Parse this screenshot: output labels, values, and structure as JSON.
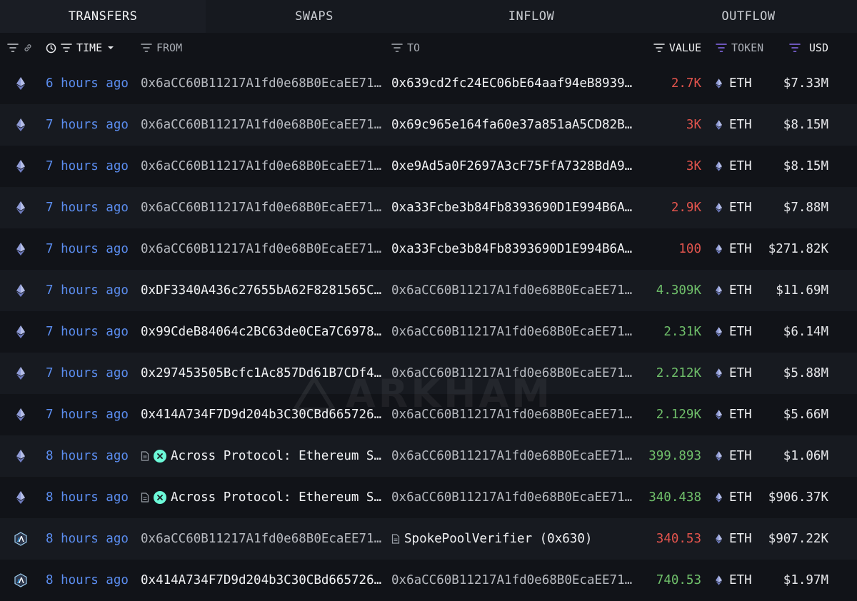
{
  "tabs": [
    {
      "label": "TRANSFERS",
      "active": true
    },
    {
      "label": "SWAPS",
      "active": false
    },
    {
      "label": "INFLOW",
      "active": false
    },
    {
      "label": "OUTFLOW",
      "active": false
    }
  ],
  "columns": {
    "time": "TIME",
    "from": "FROM",
    "to": "TO",
    "value": "VALUE",
    "token": "TOKEN",
    "usd": "USD"
  },
  "colors": {
    "negative": "#e2544d",
    "positive": "#6fbf6a",
    "time_link": "#5b8def",
    "filter_active": "#8b6cf0"
  },
  "watermark": "ARKHAM",
  "rows": [
    {
      "chain_icon": "ethereum-icon",
      "time": "6 hours ago",
      "from": "0x6aCC60B11217A1fd0e68B0EcaEE71…",
      "from_entity": false,
      "to": "0x639cd2fc24EC06bE64aaf94eB8939…",
      "to_entity": false,
      "value": "2.7K",
      "direction": "out",
      "token": "ETH",
      "usd": "$7.33M"
    },
    {
      "chain_icon": "ethereum-icon",
      "time": "7 hours ago",
      "from": "0x6aCC60B11217A1fd0e68B0EcaEE71…",
      "from_entity": false,
      "to": "0x69c965e164fa60e37a851aA5CD82B…",
      "to_entity": false,
      "value": "3K",
      "direction": "out",
      "token": "ETH",
      "usd": "$8.15M"
    },
    {
      "chain_icon": "ethereum-icon",
      "time": "7 hours ago",
      "from": "0x6aCC60B11217A1fd0e68B0EcaEE71…",
      "from_entity": false,
      "to": "0xe9Ad5a0F2697A3cF75FfA7328BdA9…",
      "to_entity": false,
      "value": "3K",
      "direction": "out",
      "token": "ETH",
      "usd": "$8.15M"
    },
    {
      "chain_icon": "ethereum-icon",
      "time": "7 hours ago",
      "from": "0x6aCC60B11217A1fd0e68B0EcaEE71…",
      "from_entity": false,
      "to": "0xa33Fcbe3b84Fb8393690D1E994B6A…",
      "to_entity": false,
      "value": "2.9K",
      "direction": "out",
      "token": "ETH",
      "usd": "$7.88M"
    },
    {
      "chain_icon": "ethereum-icon",
      "time": "7 hours ago",
      "from": "0x6aCC60B11217A1fd0e68B0EcaEE71…",
      "from_entity": false,
      "to": "0xa33Fcbe3b84Fb8393690D1E994B6A…",
      "to_entity": false,
      "value": "100",
      "direction": "out",
      "token": "ETH",
      "usd": "$271.82K"
    },
    {
      "chain_icon": "ethereum-icon",
      "time": "7 hours ago",
      "from": "0xDF3340A436c27655bA62F8281565C…",
      "from_entity": false,
      "to": "0x6aCC60B11217A1fd0e68B0EcaEE71…",
      "to_entity": false,
      "value": "4.309K",
      "direction": "in",
      "token": "ETH",
      "usd": "$11.69M"
    },
    {
      "chain_icon": "ethereum-icon",
      "time": "7 hours ago",
      "from": "0x99CdeB84064c2BC63de0CEa7C6978…",
      "from_entity": false,
      "to": "0x6aCC60B11217A1fd0e68B0EcaEE71…",
      "to_entity": false,
      "value": "2.31K",
      "direction": "in",
      "token": "ETH",
      "usd": "$6.14M"
    },
    {
      "chain_icon": "ethereum-icon",
      "time": "7 hours ago",
      "from": "0x297453505Bcfc1Ac857Dd61B7CDf4…",
      "from_entity": false,
      "to": "0x6aCC60B11217A1fd0e68B0EcaEE71…",
      "to_entity": false,
      "value": "2.212K",
      "direction": "in",
      "token": "ETH",
      "usd": "$5.88M"
    },
    {
      "chain_icon": "ethereum-icon",
      "time": "7 hours ago",
      "from": "0x414A734F7D9d204b3C30CBd665726…",
      "from_entity": false,
      "to": "0x6aCC60B11217A1fd0e68B0EcaEE71…",
      "to_entity": false,
      "value": "2.129K",
      "direction": "in",
      "token": "ETH",
      "usd": "$5.66M"
    },
    {
      "chain_icon": "ethereum-icon",
      "time": "8 hours ago",
      "from": "Across Protocol: Ethereum S…",
      "from_entity": true,
      "to": "0x6aCC60B11217A1fd0e68B0EcaEE71…",
      "to_entity": false,
      "value": "399.893",
      "direction": "in",
      "token": "ETH",
      "usd": "$1.06M"
    },
    {
      "chain_icon": "ethereum-icon",
      "time": "8 hours ago",
      "from": "Across Protocol: Ethereum S…",
      "from_entity": true,
      "to": "0x6aCC60B11217A1fd0e68B0EcaEE71…",
      "to_entity": false,
      "value": "340.438",
      "direction": "in",
      "token": "ETH",
      "usd": "$906.37K"
    },
    {
      "chain_icon": "arbitrum-icon",
      "time": "8 hours ago",
      "from": "0x6aCC60B11217A1fd0e68B0EcaEE71…",
      "from_entity": false,
      "to": "SpokePoolVerifier (0x630)",
      "to_entity": true,
      "value": "340.53",
      "direction": "out",
      "token": "ETH",
      "usd": "$907.22K"
    },
    {
      "chain_icon": "arbitrum-icon",
      "time": "8 hours ago",
      "from": "0x414A734F7D9d204b3C30CBd665726…",
      "from_entity": false,
      "to": "0x6aCC60B11217A1fd0e68B0EcaEE71…",
      "to_entity": false,
      "value": "740.53",
      "direction": "in",
      "token": "ETH",
      "usd": "$1.97M"
    }
  ]
}
